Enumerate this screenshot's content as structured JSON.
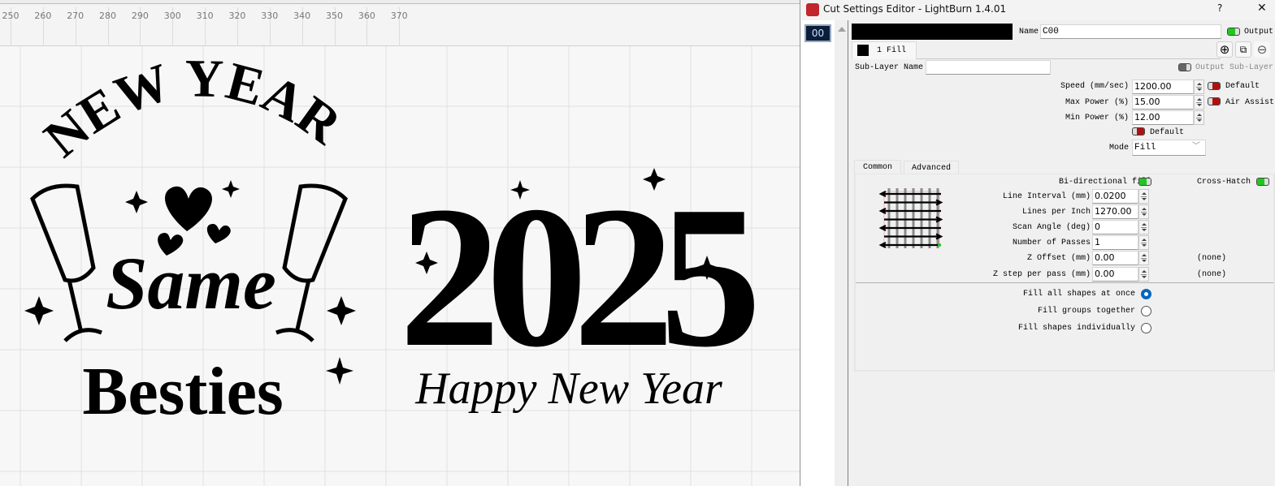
{
  "canvas": {
    "ruler_labels": [
      "250",
      "260",
      "270",
      "280",
      "290",
      "300",
      "310",
      "320",
      "330",
      "340",
      "350",
      "360",
      "370"
    ],
    "artwork": {
      "left_design": {
        "line1": "NEW YEAR",
        "line2": "Same",
        "line3": "Besties"
      },
      "right_design": {
        "year": "2025",
        "script": "Happy New Year"
      }
    }
  },
  "dialog": {
    "title": "Cut Settings Editor - LightBurn 1.4.01",
    "help_label": "?",
    "close_label": "✕",
    "layer_list": [
      {
        "label": "00",
        "color": "#0a1e3c"
      }
    ],
    "layer_color": "#000000",
    "name_label": "Name",
    "name_value": "C00",
    "output_label": "Output",
    "output_on": true,
    "sublayer_tab": "1 Fill",
    "sublayer_name_label": "Sub-Layer Name",
    "sublayer_name_value": "",
    "output_sublayer_label": "Output Sub-Layer",
    "speed": {
      "label": "Speed (mm/sec)",
      "value": "1200.00",
      "toggle_label": "Default"
    },
    "max_power": {
      "label": "Max Power (%)",
      "value": "15.00",
      "toggle_label": "Air Assist"
    },
    "min_power": {
      "label": "Min Power (%)",
      "value": "12.00"
    },
    "default_toggle_label": "Default",
    "mode": {
      "label": "Mode",
      "value": "Fill"
    },
    "tabs": [
      {
        "label": "Common",
        "active": true
      },
      {
        "label": "Advanced",
        "active": false
      }
    ],
    "common": {
      "bidirectional_label": "Bi-directional fill",
      "bidirectional_on": true,
      "crosshatch_label": "Cross-Hatch",
      "crosshatch_on": true,
      "fields": [
        {
          "label": "Line Interval (mm)",
          "value": "0.0200",
          "note": ""
        },
        {
          "label": "Lines per Inch",
          "value": "1270.00",
          "note": ""
        },
        {
          "label": "Scan Angle (deg)",
          "value": "0",
          "note": ""
        },
        {
          "label": "Number of Passes",
          "value": "1",
          "note": ""
        },
        {
          "label": "Z Offset (mm)",
          "value": "0.00",
          "note": "(none)"
        },
        {
          "label": "Z step per pass (mm)",
          "value": "0.00",
          "note": "(none)"
        }
      ],
      "fill_options": [
        {
          "label": "Fill all shapes at once",
          "selected": true
        },
        {
          "label": "Fill groups together",
          "selected": false
        },
        {
          "label": "Fill shapes individually",
          "selected": false
        }
      ]
    },
    "colors": {
      "toggle_on": "#1ec81e",
      "toggle_off": "#b01010",
      "radio": "#0067c0"
    }
  }
}
